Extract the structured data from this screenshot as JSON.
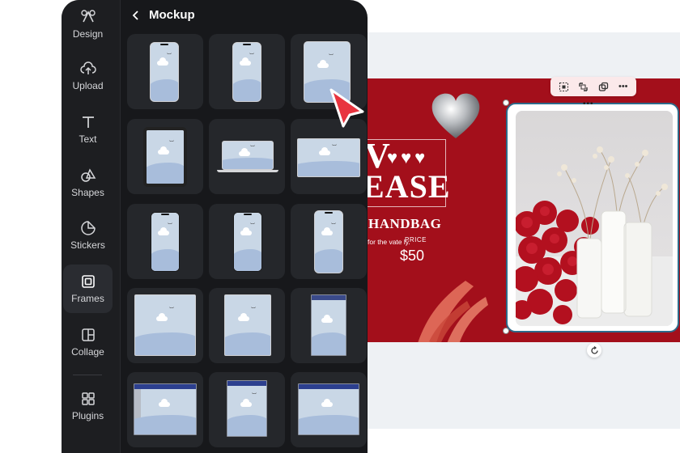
{
  "sidebar": {
    "items": [
      {
        "label": "Design",
        "icon": "design-icon"
      },
      {
        "label": "Upload",
        "icon": "upload-icon"
      },
      {
        "label": "Text",
        "icon": "text-icon"
      },
      {
        "label": "Shapes",
        "icon": "shapes-icon"
      },
      {
        "label": "Stickers",
        "icon": "stickers-icon"
      },
      {
        "label": "Frames",
        "icon": "frames-icon",
        "active": true
      },
      {
        "label": "Collage",
        "icon": "collage-icon"
      },
      {
        "label": "Plugins",
        "icon": "plugins-icon"
      }
    ]
  },
  "panel": {
    "title": "Mockup",
    "back_icon": "chevron-left-icon"
  },
  "design": {
    "title_line1": "V",
    "title_line2": "EASE",
    "hearts": "♥♥♥",
    "subtitle": "HANDBAG",
    "description": "for the vate ly.",
    "price_label": "PRICE",
    "price": "$50"
  },
  "toolbar": {
    "icons": [
      "crop-icon",
      "replace-icon",
      "duplicate-icon",
      "more-icon"
    ]
  },
  "colors": {
    "panel_bg": "#17181b",
    "rail_bg": "#1d1e21",
    "tile_bg": "#25272b",
    "design_red": "#a30f1b",
    "accent_cursor": "#e8343f",
    "frame_border": "#2d6a8a"
  }
}
